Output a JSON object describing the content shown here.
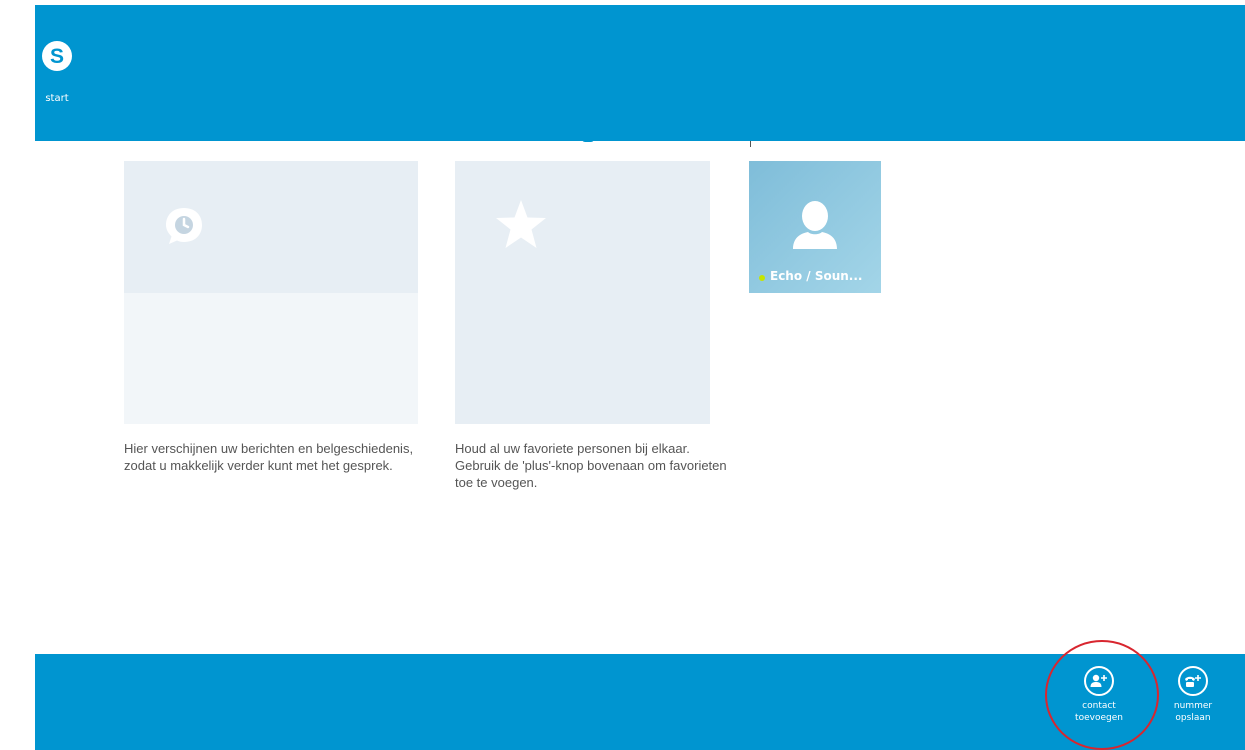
{
  "top_bar": {
    "start_label": "start",
    "start_icon": "skype-logo-icon"
  },
  "panels": {
    "recent": {
      "icon": "chat-clock-icon",
      "description": "Hier verschijnen uw berichten en belgeschiedenis, zodat u makkelijk verder kunt met het gesprek."
    },
    "favorites": {
      "icon": "star-icon",
      "description": "Houd al uw favoriete personen bij elkaar. Gebruik de 'plus'-knop bovenaan om favorieten toe te voegen."
    }
  },
  "contacts": [
    {
      "name": "Echo / Soun...",
      "status": "online",
      "status_color": "#c5e600",
      "icon": "person-avatar-icon"
    }
  ],
  "app_bar": {
    "buttons": [
      {
        "label_line1": "contact",
        "label_line2": "toevoegen",
        "icon": "add-contact-icon"
      },
      {
        "label_line1": "nummer",
        "label_line2": "opslaan",
        "icon": "add-phone-icon"
      }
    ]
  },
  "colors": {
    "accent": "#0095d0",
    "tile_light": "#e7eef4",
    "tile_lighter": "#f2f6f9",
    "highlight_ring": "#d8262f"
  }
}
